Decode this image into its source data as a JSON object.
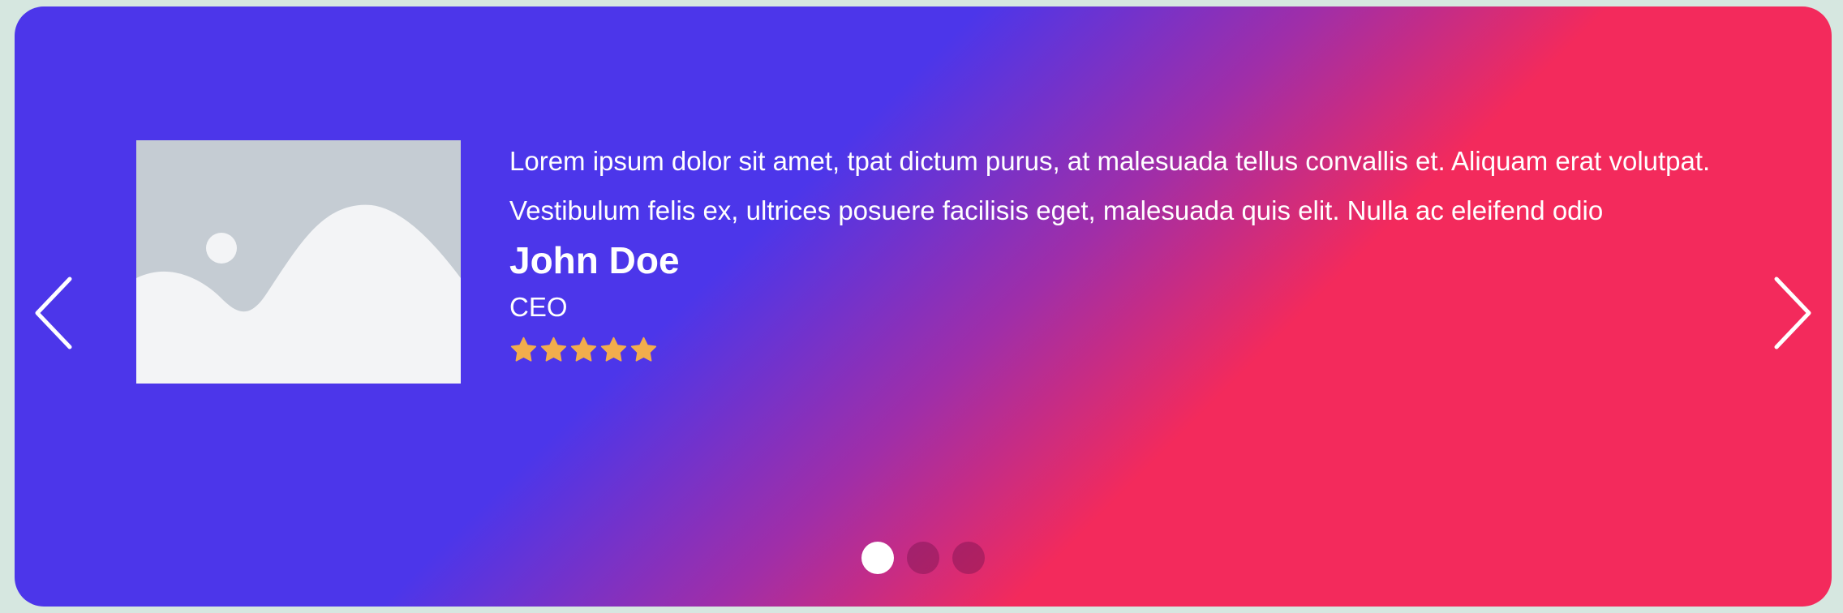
{
  "colors": {
    "page_background": "#d6e7e0",
    "gradient_start": "#4c36ea",
    "gradient_end": "#f32a5c",
    "star": "#f2ad4c",
    "dot_active": "#ffffff",
    "dot_inactive": "rgba(120,20,80,0.45)",
    "placeholder_bg": "#c5ccd3",
    "placeholder_fg": "#f3f4f6"
  },
  "icons": {
    "prev": "chevron-left-icon",
    "next": "chevron-right-icon",
    "photo": "image-placeholder-icon",
    "rating": "star-icon"
  },
  "testimonial": {
    "quote": "Lorem ipsum dolor sit amet, tpat dictum purus, at malesuada tellus convallis et. Aliquam erat volutpat. Vestibulum felis ex, ultrices posuere facilisis eget, malesuada quis elit. Nulla ac eleifend odio",
    "name": "John Doe",
    "role": "CEO",
    "rating": 5,
    "rating_max": 5
  },
  "pagination": {
    "total": 3,
    "active_index": 0
  }
}
